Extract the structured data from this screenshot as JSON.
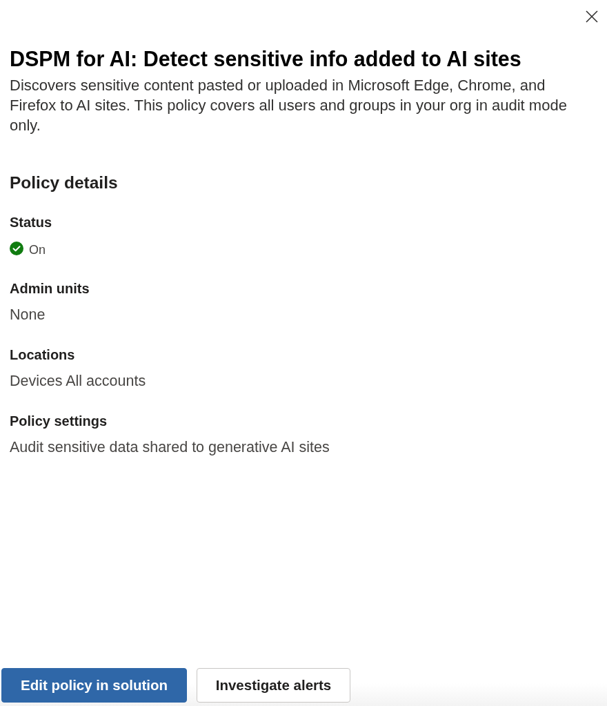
{
  "panel": {
    "title": "DSPM for AI: Detect sensitive info added to AI sites",
    "description": "Discovers sensitive content pasted or uploaded in Microsoft Edge, Chrome, and Firefox to AI sites. This policy covers all users and groups in your org in audit mode only."
  },
  "policy_details": {
    "heading": "Policy details",
    "items": [
      {
        "kind": "status",
        "label": "Status",
        "value": "On",
        "on": true
      },
      {
        "kind": "text",
        "label": "Admin units",
        "value": "None"
      },
      {
        "kind": "text",
        "label": "Locations",
        "value": "Devices All accounts"
      },
      {
        "kind": "text",
        "label": "Policy settings",
        "value": "Audit sensitive data shared to generative AI sites"
      }
    ]
  },
  "buttons": [
    {
      "kind": "primary",
      "label": "Edit policy in solution"
    },
    {
      "kind": "secondary",
      "label": "Investigate alerts"
    }
  ]
}
